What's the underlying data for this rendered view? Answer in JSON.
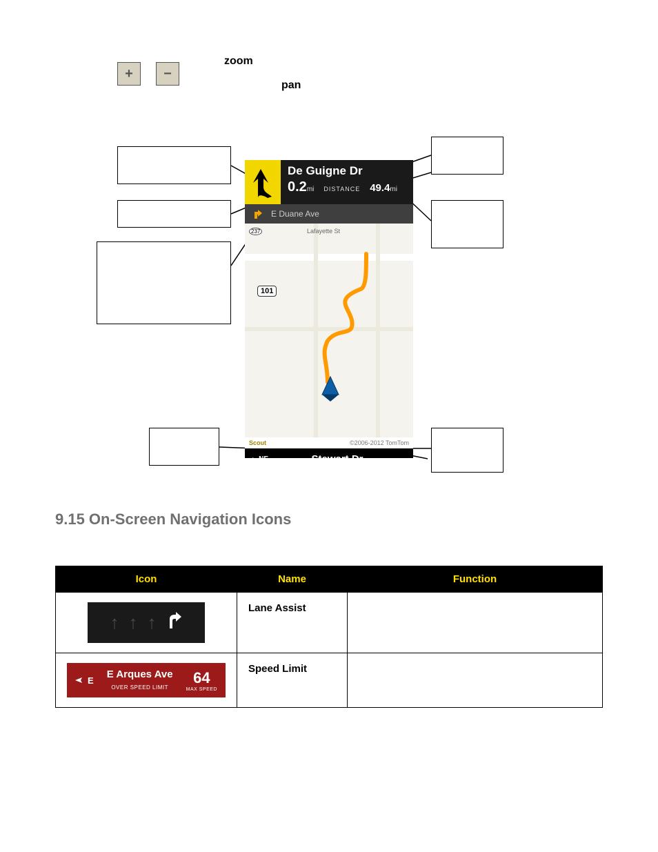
{
  "labels": {
    "zoom": "zoom",
    "pan": "pan"
  },
  "buttons": {
    "plus": "+",
    "minus": "−"
  },
  "nav": {
    "primary_street": "De Guigne Dr",
    "primary_dist_value": "0.2",
    "primary_dist_unit": "mi",
    "total_label": "DISTANCE",
    "total_value": "49.4",
    "total_unit": "mi",
    "next_street": "E Duane Ave",
    "map_label_1": "Lafayette St",
    "hwy_101": "101",
    "hwy_237": "237",
    "brand": "Scout",
    "copyright": "©2006-2012 TomTom",
    "compass": "NE",
    "current_street": "Stewart Dr"
  },
  "section": {
    "heading": "9.15 On-Screen Navigation Icons"
  },
  "table": {
    "headers": {
      "icon": "Icon",
      "name": "Name",
      "function": "Function"
    },
    "rows": [
      {
        "name": "Lane Assist",
        "function": ""
      },
      {
        "name": "Speed Limit",
        "function": ""
      }
    ]
  },
  "speed_limit_icon": {
    "direction": "E",
    "street": "E Arques Ave",
    "sub": "OVER SPEED LIMIT",
    "value": "64",
    "value_sub": "MAX SPEED"
  }
}
